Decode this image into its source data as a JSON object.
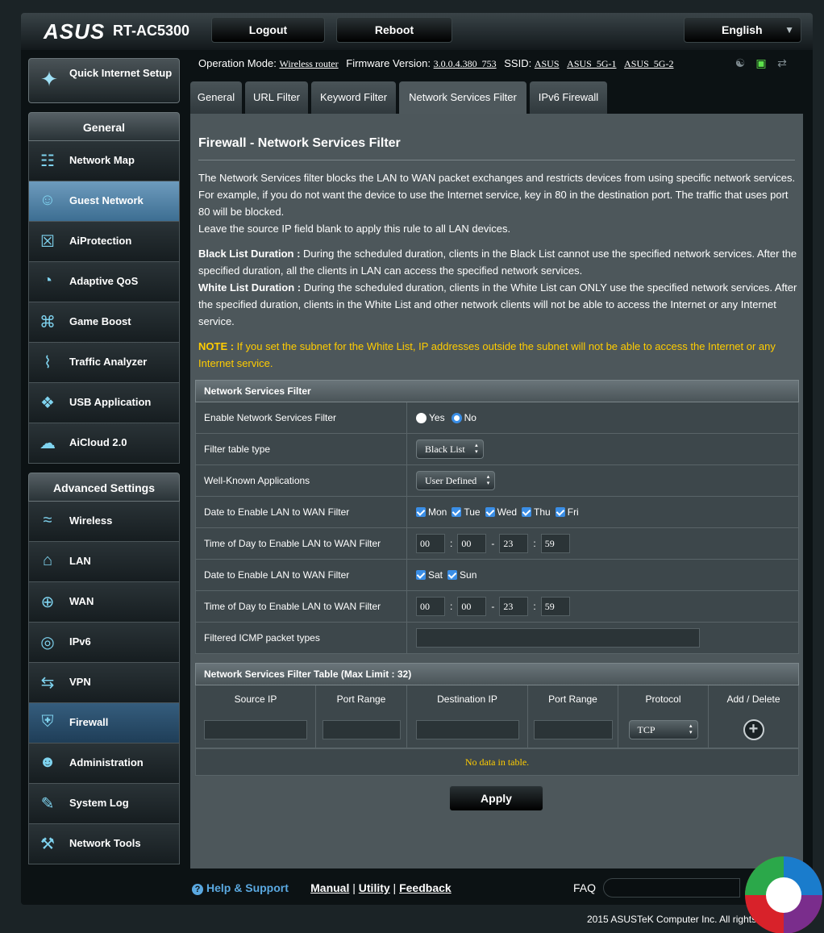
{
  "header": {
    "brand": "ASUS",
    "model": "RT-AC5300",
    "logout": "Logout",
    "reboot": "Reboot",
    "language": "English"
  },
  "status": {
    "op_mode_label": "Operation Mode:",
    "op_mode": "Wireless router",
    "fw_label": "Firmware Version:",
    "fw": "3.0.0.4.380_753",
    "ssid_label": "SSID:",
    "ssid1": "ASUS",
    "ssid2": "ASUS_5G-1",
    "ssid3": "ASUS_5G-2"
  },
  "sidebar": {
    "qis": "Quick Internet Setup",
    "general_head": "General",
    "general": [
      {
        "label": "Network Map",
        "icon": "network-map-icon"
      },
      {
        "label": "Guest Network",
        "icon": "guest-network-icon"
      },
      {
        "label": "AiProtection",
        "icon": "aiprotection-icon"
      },
      {
        "label": "Adaptive QoS",
        "icon": "qos-gauge-icon"
      },
      {
        "label": "Game Boost",
        "icon": "gamepad-icon"
      },
      {
        "label": "Traffic Analyzer",
        "icon": "traffic-chart-icon"
      },
      {
        "label": "USB Application",
        "icon": "puzzle-icon"
      },
      {
        "label": "AiCloud 2.0",
        "icon": "cloud-icon"
      }
    ],
    "advanced_head": "Advanced Settings",
    "advanced": [
      {
        "label": "Wireless",
        "icon": "wifi-icon"
      },
      {
        "label": "LAN",
        "icon": "home-icon"
      },
      {
        "label": "WAN",
        "icon": "globe-icon"
      },
      {
        "label": "IPv6",
        "icon": "ipv6-icon"
      },
      {
        "label": "VPN",
        "icon": "vpn-icon"
      },
      {
        "label": "Firewall",
        "icon": "shield-icon"
      },
      {
        "label": "Administration",
        "icon": "admin-user-icon"
      },
      {
        "label": "System Log",
        "icon": "log-edit-icon"
      },
      {
        "label": "Network Tools",
        "icon": "tools-icon"
      }
    ]
  },
  "tabs": [
    "General",
    "URL Filter",
    "Keyword Filter",
    "Network Services Filter",
    "IPv6 Firewall"
  ],
  "main": {
    "title": "Firewall - Network Services Filter",
    "p1": "The Network Services filter blocks the LAN to WAN packet exchanges and restricts devices from using specific network services. For example, if you do not want the device to use the Internet service, key in 80 in the destination port. The traffic that uses port 80 will be blocked.",
    "p1b": "Leave the source IP field blank to apply this rule to all LAN devices.",
    "black_label": "Black List Duration :",
    "black_text": " During the scheduled duration, clients in the Black List cannot use the specified network services. After the specified duration, all the clients in LAN can access the specified network services.",
    "white_label": "White List Duration :",
    "white_text": " During the scheduled duration, clients in the White List can ONLY use the specified network services. After the specified duration, clients in the White List and other network clients will not be able to access the Internet or any Internet service.",
    "note_label": "NOTE :",
    "note_text": " If you set the subnet for the White List, IP addresses outside the subnet will not be able to access the Internet or any Internet service."
  },
  "filter": {
    "head": "Network Services Filter",
    "enable_label": "Enable Network Services Filter",
    "yes": "Yes",
    "no": "No",
    "type_label": "Filter table type",
    "type_value": "Black List",
    "apps_label": "Well-Known Applications",
    "apps_value": "User Defined",
    "date1_label": "Date to Enable LAN to WAN Filter",
    "weekdays": [
      "Mon",
      "Tue",
      "Wed",
      "Thu",
      "Fri"
    ],
    "time1_label": "Time of Day to Enable LAN to WAN Filter",
    "time1": [
      "00",
      "00",
      "23",
      "59"
    ],
    "date2_label": "Date to Enable LAN to WAN Filter",
    "weekend": [
      "Sat",
      "Sun"
    ],
    "time2_label": "Time of Day to Enable LAN to WAN Filter",
    "time2": [
      "00",
      "00",
      "23",
      "59"
    ],
    "icmp_label": "Filtered ICMP packet types"
  },
  "rules": {
    "head": "Network Services Filter Table (Max Limit : 32)",
    "columns": [
      "Source IP",
      "Port Range",
      "Destination IP",
      "Port Range",
      "Protocol",
      "Add / Delete"
    ],
    "protocol": "TCP",
    "nodata": "No data in table."
  },
  "apply": "Apply",
  "footer": {
    "help": "Help & Support",
    "manual": "Manual",
    "utility": "Utility",
    "feedback": "Feedback",
    "faq": "FAQ",
    "copyright": "2015 ASUSTeK Computer Inc. All rights reserved."
  }
}
